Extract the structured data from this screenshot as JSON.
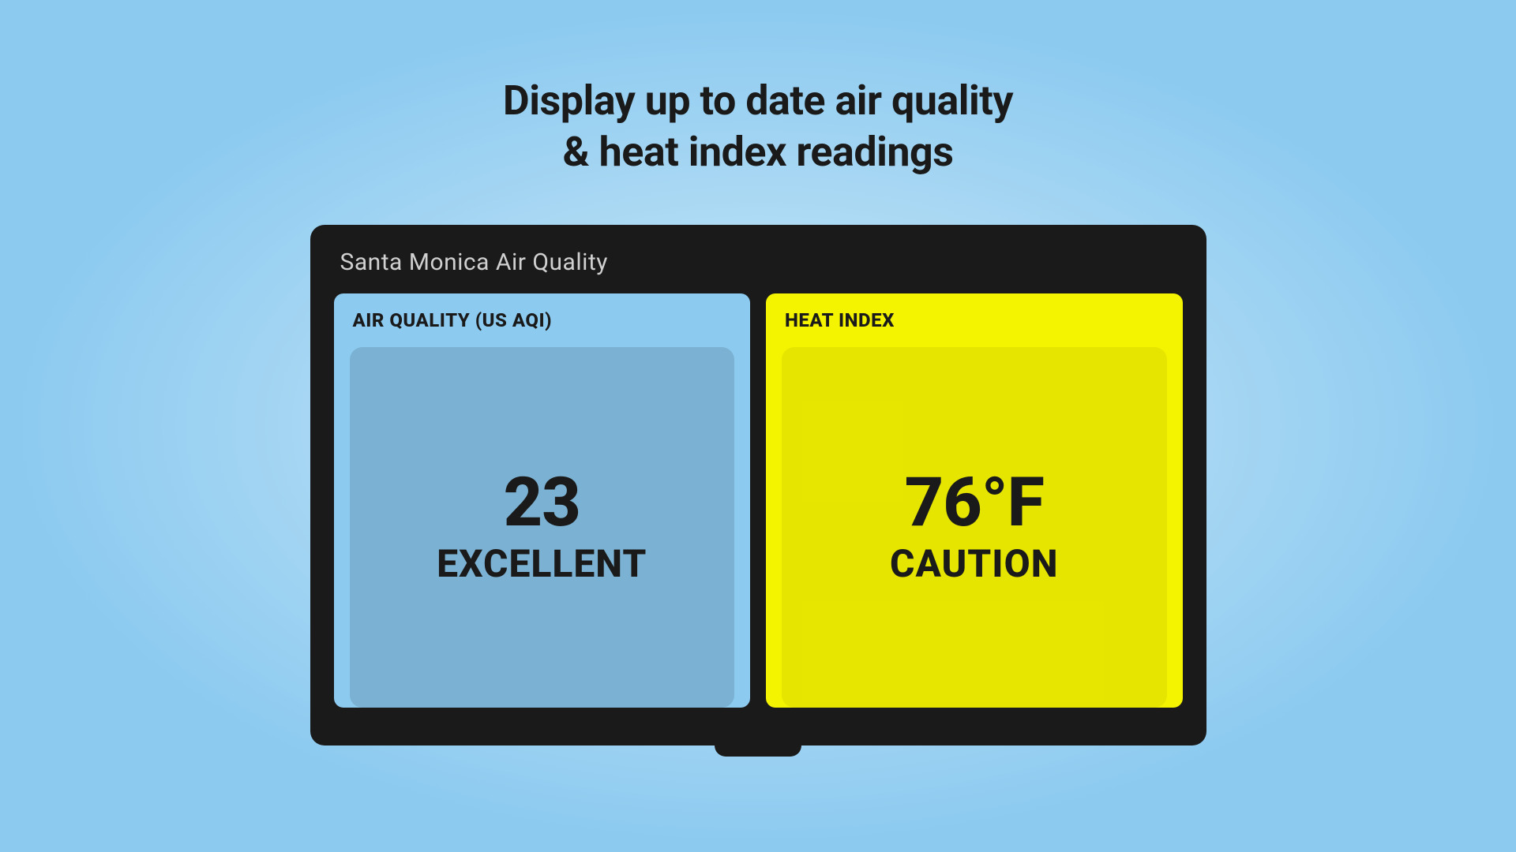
{
  "headline": {
    "line1": "Display up to date air quality",
    "line2": "& heat index readings"
  },
  "screen": {
    "title": "Santa Monica Air Quality",
    "panels": {
      "air_quality": {
        "label": "AIR QUALITY (US AQI)",
        "value": "23",
        "status": "EXCELLENT",
        "bg_color": "#8ccaf0"
      },
      "heat_index": {
        "label": "HEAT INDEX",
        "value": "76°F",
        "status": "CAUTION",
        "bg_color": "#f4f400"
      }
    }
  }
}
